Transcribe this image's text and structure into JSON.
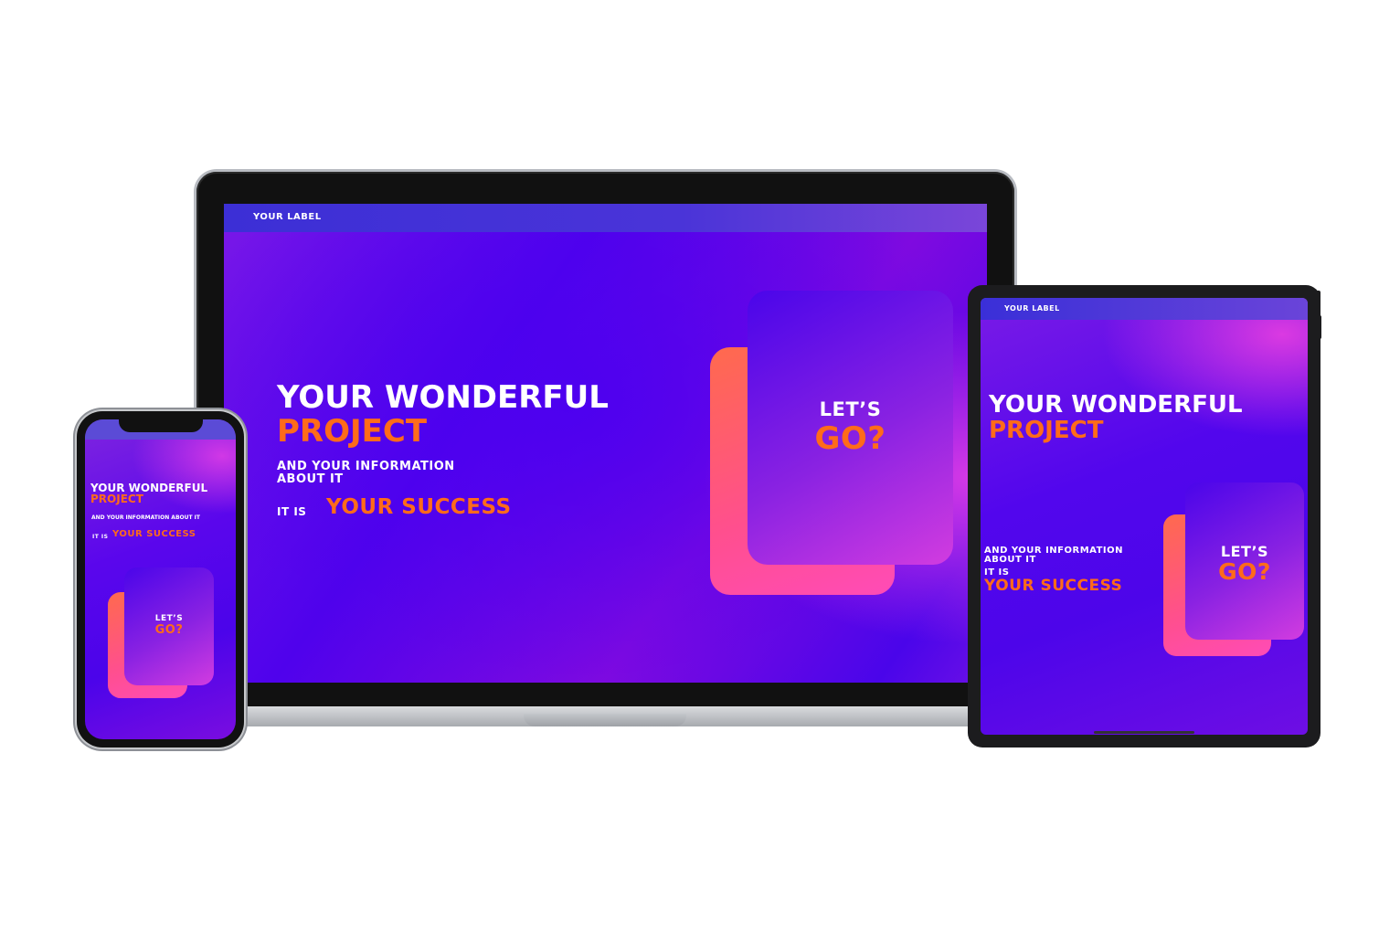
{
  "colors": {
    "accent": "#ff6b1a",
    "background_purple": "#4f02ec",
    "card_pink": "#ff4f8e"
  },
  "laptop": {
    "label": "YOUR LABEL",
    "headline_line1": "YOUR WONDERFUL",
    "headline_line2": "PROJECT",
    "info_line1": "AND YOUR INFORMATION",
    "info_line2": "ABOUT IT",
    "it_is": "IT IS",
    "success": "YOUR SUCCESS",
    "cta_line1": "LET’S",
    "cta_line2": "GO?"
  },
  "phone": {
    "headline_line1": "YOUR WONDERFUL",
    "headline_line2": "PROJECT",
    "info": "AND YOUR INFORMATION ABOUT IT",
    "it_is": "IT IS",
    "success": "YOUR SUCCESS",
    "cta_line1": "LET’S",
    "cta_line2": "GO?"
  },
  "tablet": {
    "label": "YOUR LABEL",
    "headline_line1": "YOUR WONDERFUL",
    "headline_line2": "PROJECT",
    "info_line1": "AND YOUR INFORMATION",
    "info_line2": "ABOUT IT",
    "it_is": "IT IS",
    "success": "YOUR SUCCESS",
    "cta_line1": "LET’S",
    "cta_line2": "GO?"
  }
}
